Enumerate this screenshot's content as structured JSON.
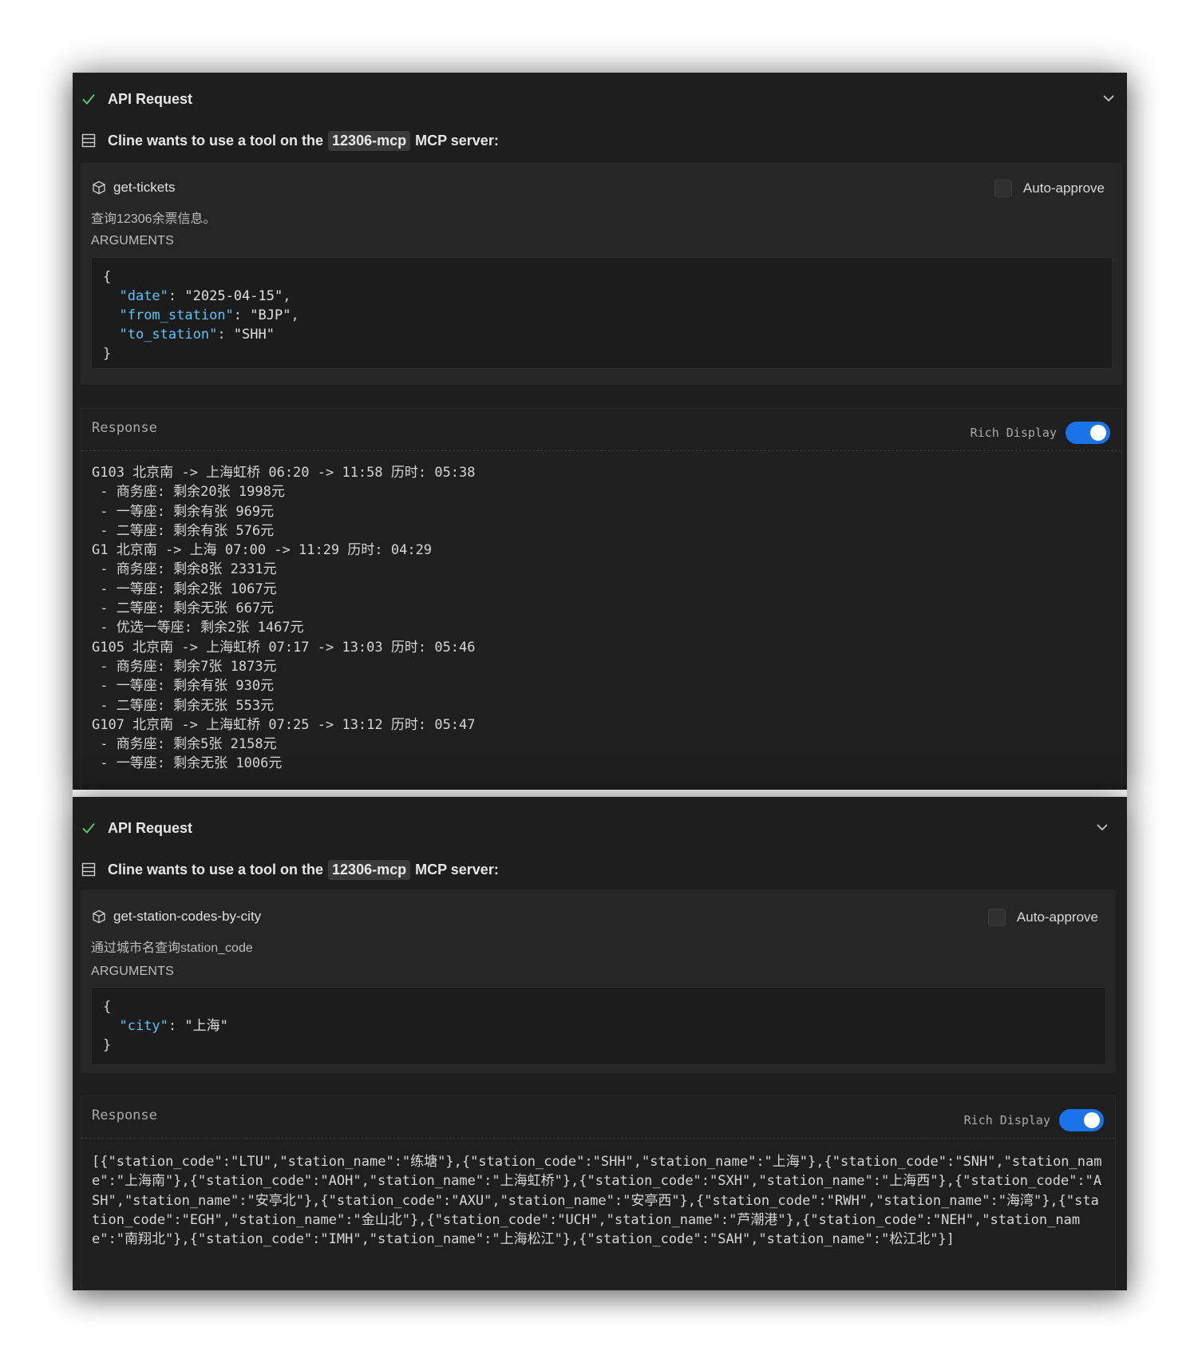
{
  "panel1": {
    "header": {
      "title": "API Request"
    },
    "server": {
      "prefix": "Cline wants to use a tool on the",
      "name": "12306-mcp",
      "suffix": "MCP server:"
    },
    "tool": {
      "name": "get-tickets",
      "description": "查询12306余票信息。",
      "args_label": "ARGUMENTS",
      "auto_approve": "Auto-approve",
      "args": {
        "open": "{",
        "close": "}",
        "date_key": "\"date\"",
        "date_val": "\"2025-04-15\"",
        "from_key": "\"from_station\"",
        "from_val": "\"BJP\"",
        "to_key": "\"to_station\"",
        "to_val": "\"SHH\""
      }
    },
    "response": {
      "title": "Response",
      "rich_label": "Rich Display",
      "rich_enabled": true,
      "lines": [
        "G103 北京南 -> 上海虹桥 06:20 -> 11:58 历时: 05:38",
        " - 商务座: 剩余20张 1998元",
        " - 一等座: 剩余有张 969元",
        " - 二等座: 剩余有张 576元",
        "G1 北京南 -> 上海 07:00 -> 11:29 历时: 04:29",
        " - 商务座: 剩余8张 2331元",
        " - 一等座: 剩余2张 1067元",
        " - 二等座: 剩余无张 667元",
        " - 优选一等座: 剩余2张 1467元",
        "G105 北京南 -> 上海虹桥 07:17 -> 13:03 历时: 05:46",
        " - 商务座: 剩余7张 1873元",
        " - 一等座: 剩余有张 930元",
        " - 二等座: 剩余无张 553元",
        "G107 北京南 -> 上海虹桥 07:25 -> 13:12 历时: 05:47",
        " - 商务座: 剩余5张 2158元",
        " - 一等座: 剩余无张 1006元"
      ]
    }
  },
  "panel2": {
    "header": {
      "title": "API Request"
    },
    "server": {
      "prefix": "Cline wants to use a tool on the",
      "name": "12306-mcp",
      "suffix": "MCP server:"
    },
    "tool": {
      "name": "get-station-codes-by-city",
      "description": "通过城市名查询station_code",
      "args_label": "ARGUMENTS",
      "auto_approve": "Auto-approve",
      "args": {
        "open": "{",
        "close": "}",
        "city_key": "\"city\"",
        "city_val": "\"上海\""
      }
    },
    "response": {
      "title": "Response",
      "rich_label": "Rich Display",
      "rich_enabled": true,
      "body": "[{\"station_code\":\"LTU\",\"station_name\":\"练塘\"},{\"station_code\":\"SHH\",\"station_name\":\"上海\"},{\"station_code\":\"SNH\",\"station_name\":\"上海南\"},{\"station_code\":\"AOH\",\"station_name\":\"上海虹桥\"},{\"station_code\":\"SXH\",\"station_name\":\"上海西\"},{\"station_code\":\"ASH\",\"station_name\":\"安亭北\"},{\"station_code\":\"AXU\",\"station_name\":\"安亭西\"},{\"station_code\":\"RWH\",\"station_name\":\"海湾\"},{\"station_code\":\"EGH\",\"station_name\":\"金山北\"},{\"station_code\":\"UCH\",\"station_name\":\"芦潮港\"},{\"station_code\":\"NEH\",\"station_name\":\"南翔北\"},{\"station_code\":\"IMH\",\"station_name\":\"上海松江\"},{\"station_code\":\"SAH\",\"station_name\":\"松江北\"}]"
    }
  }
}
